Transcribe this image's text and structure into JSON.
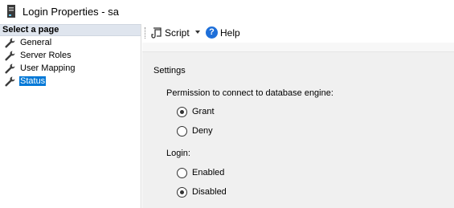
{
  "window": {
    "title": "Login Properties - sa",
    "icon": "server-icon"
  },
  "sidebar": {
    "header": "Select a page",
    "items": [
      {
        "label": "General",
        "icon": "wrench-icon",
        "selected": false
      },
      {
        "label": "Server Roles",
        "icon": "wrench-icon",
        "selected": false
      },
      {
        "label": "User Mapping",
        "icon": "wrench-icon",
        "selected": false
      },
      {
        "label": "Status",
        "icon": "wrench-icon",
        "selected": true
      }
    ]
  },
  "toolbar": {
    "script_label": "Script",
    "help_label": "Help",
    "help_glyph": "?"
  },
  "settings": {
    "title": "Settings",
    "permission_label": "Permission to connect to database engine:",
    "permission_options": [
      {
        "label": "Grant",
        "checked": true
      },
      {
        "label": "Deny",
        "checked": false
      }
    ],
    "login_label": "Login:",
    "login_options": [
      {
        "label": "Enabled",
        "checked": false
      },
      {
        "label": "Disabled",
        "checked": true
      }
    ]
  },
  "colors": {
    "accent": "#0078d7",
    "sidebar_header_bg": "#dfe5ee",
    "panel_bg": "#f0f0f0",
    "help_icon": "#1e6fd9"
  }
}
